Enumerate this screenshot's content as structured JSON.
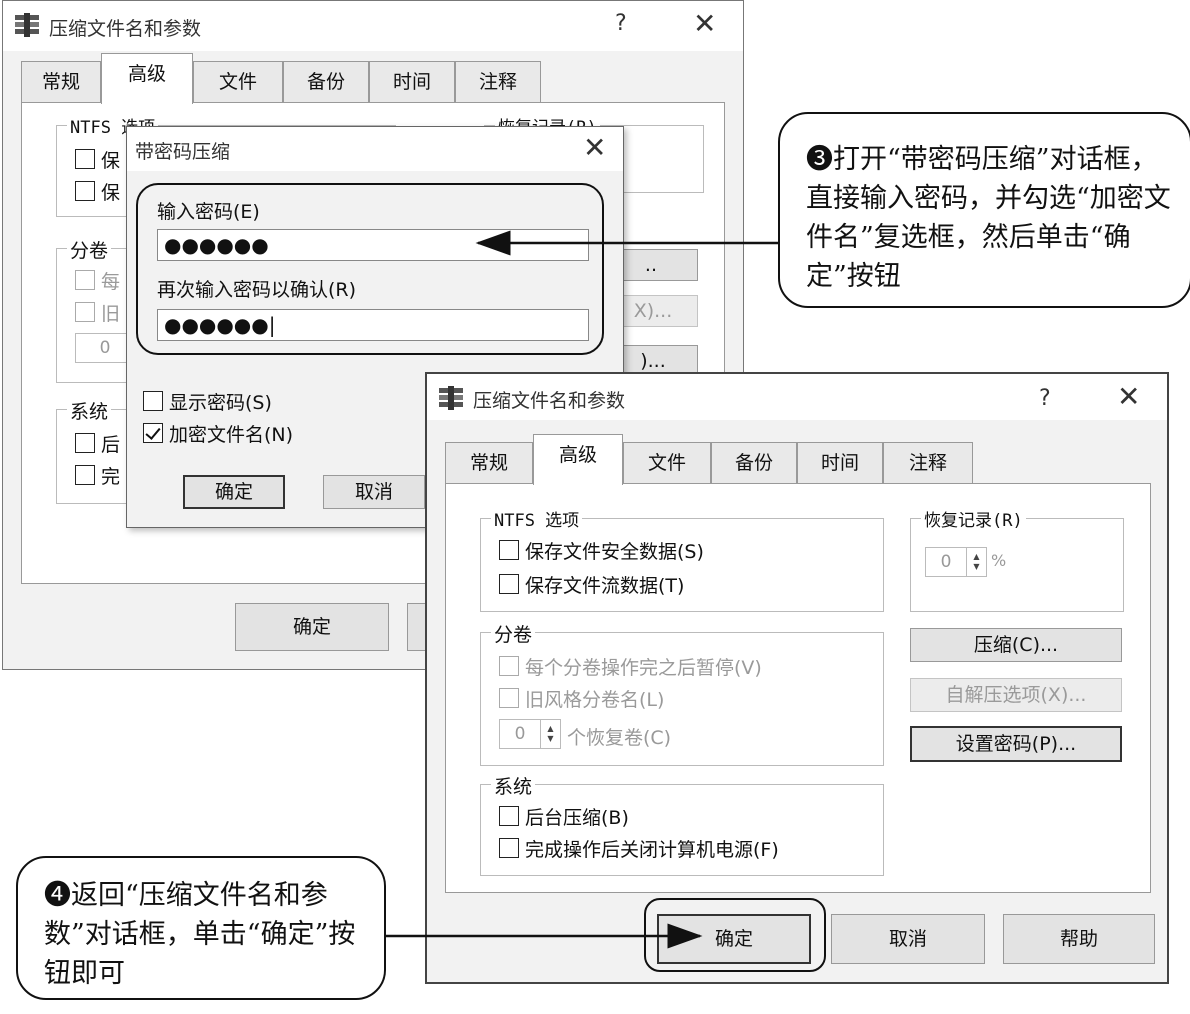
{
  "back_dialog": {
    "title": "压缩文件名和参数",
    "help_symbol": "?",
    "close_symbol": "✕",
    "tabs": [
      "常规",
      "高级",
      "文件",
      "备份",
      "时间",
      "注释"
    ],
    "ntfs_label": "NTFS 选项",
    "ntfs_items": [
      "保",
      "保"
    ],
    "recovery_label": "恢复记录(R)",
    "volumes_label": "分卷",
    "volume_items": [
      "每",
      "旧"
    ],
    "volume_count": "0",
    "system_label": "系统",
    "system_items": [
      "后",
      "完"
    ],
    "button_partials": [
      "..",
      "X)...",
      ")..."
    ],
    "ok_label": "确定"
  },
  "password_dialog": {
    "title": "带密码压缩",
    "close_symbol": "✕",
    "enter_label": "输入密码(E)",
    "enter_value": "●●●●●●",
    "confirm_label": "再次输入密码以确认(R)",
    "confirm_value": "●●●●●●|",
    "show_password_label": "显示密码(S)",
    "show_password_checked": false,
    "encrypt_names_label": "加密文件名(N)",
    "encrypt_names_checked": true,
    "ok_label": "确定",
    "cancel_label": "取消"
  },
  "front_dialog": {
    "title": "压缩文件名和参数",
    "help_symbol": "?",
    "close_symbol": "✕",
    "tabs": [
      "常规",
      "高级",
      "文件",
      "备份",
      "时间",
      "注释"
    ],
    "active_tab": "高级",
    "ntfs_label": "NTFS 选项",
    "ntfs_items": [
      "保存文件安全数据(S)",
      "保存文件流数据(T)"
    ],
    "recovery_label": "恢复记录(R)",
    "recovery_value": "0",
    "recovery_unit": "%",
    "volumes_label": "分卷",
    "volume_items": [
      "每个分卷操作完之后暂停(V)",
      "旧风格分卷名(L)"
    ],
    "recovery_volumes_value": "0",
    "recovery_volumes_label": "个恢复卷(C)",
    "system_label": "系统",
    "system_items": [
      "后台压缩(B)",
      "完成操作后关闭计算机电源(F)"
    ],
    "compress_button": "压缩(C)...",
    "sfx_button": "自解压选项(X)...",
    "password_button": "设置密码(P)...",
    "ok_label": "确定",
    "cancel_label": "取消",
    "help_label": "帮助"
  },
  "callouts": {
    "step3": "❸打开“带密码压缩”对话框，直接输入密码，并勾选“加密文件名”复选框，然后单击“确定”按钮",
    "step4": "❹返回“压缩文件名和参数”对话框，单击“确定”按钮即可"
  }
}
